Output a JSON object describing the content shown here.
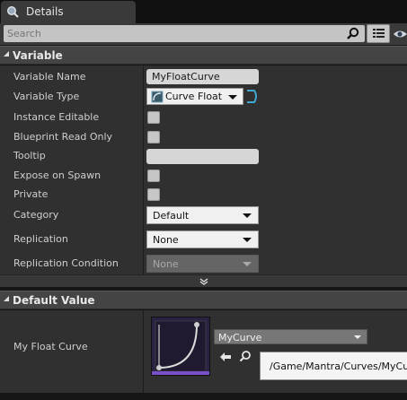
{
  "tab": {
    "label": "Details",
    "icon": "magnifier-icon"
  },
  "search": {
    "placeholder": "Search"
  },
  "variable_section": {
    "title": "Variable",
    "rows": {
      "variable_name": {
        "label": "Variable Name",
        "value": "MyFloatCurve"
      },
      "variable_type": {
        "label": "Variable Type",
        "value": "Curve Float"
      },
      "instance_editable": {
        "label": "Instance Editable",
        "checked": false
      },
      "blueprint_read_only": {
        "label": "Blueprint Read Only",
        "checked": false
      },
      "tooltip": {
        "label": "Tooltip",
        "value": ""
      },
      "expose_on_spawn": {
        "label": "Expose on Spawn",
        "checked": false
      },
      "private": {
        "label": "Private",
        "checked": false
      },
      "category": {
        "label": "Category",
        "value": "Default"
      },
      "replication": {
        "label": "Replication",
        "value": "None"
      },
      "replication_condition": {
        "label": "Replication Condition",
        "value": "None"
      }
    }
  },
  "default_value_section": {
    "title": "Default Value",
    "property": {
      "label": "My Float Curve",
      "asset": "MyCurve"
    },
    "path_tooltip": "/Game/Mantra/Curves/MyCurve"
  },
  "colors": {
    "accent_purple": "#7a50c8",
    "panel": "#303030",
    "header": "#444444"
  }
}
